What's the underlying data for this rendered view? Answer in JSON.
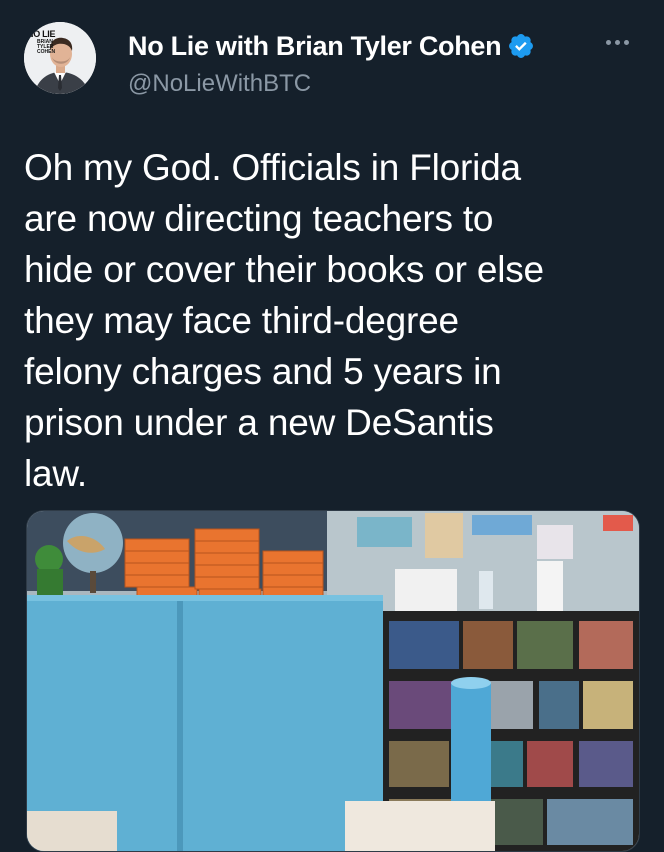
{
  "tweet": {
    "author": {
      "display_name": "No Lie with Brian Tyler Cohen",
      "handle": "@NoLieWithBTC",
      "verified": true,
      "avatar_logo_line1": "NO LIE",
      "avatar_logo_line2": "BRIAN TYLER COHEN"
    },
    "text": "Oh my God. Officials in Florida\nare now directing teachers to\nhide or cover their books or else\nthey may face third-degree\nfelony charges and 5 years in\nprison under a new DeSantis\nlaw.",
    "more_icon": "more-horizontal-icon",
    "media": {
      "description_icon": "photo-icon"
    }
  },
  "colors": {
    "background": "#15202b",
    "text": "#ffffff",
    "secondary_text": "#8b98a5",
    "verified_badge": "#1d9bf0"
  }
}
